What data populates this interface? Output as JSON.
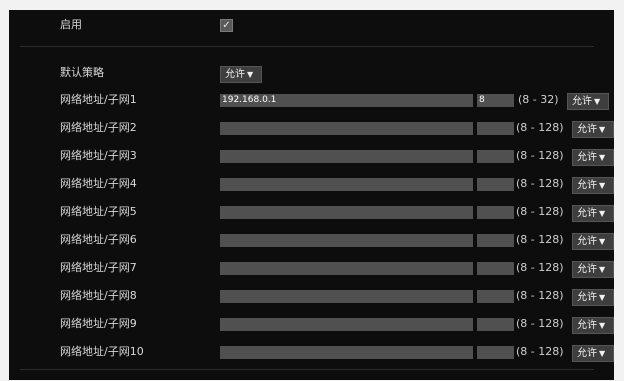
{
  "enable": {
    "label": "启用",
    "checked": true,
    "check_glyph": "✓"
  },
  "default_policy": {
    "label": "默认策略",
    "value": "允许",
    "arrow": "▼"
  },
  "rows": [
    {
      "label": "网络地址/子网1",
      "address": "192.168.0.1",
      "mask": "8",
      "range": "(8 - 32)",
      "policy": "允许",
      "arrow": "▼"
    },
    {
      "label": "网络地址/子网2",
      "address": "",
      "mask": "",
      "range": "(8 - 128)",
      "policy": "允许",
      "arrow": "▼"
    },
    {
      "label": "网络地址/子网3",
      "address": "",
      "mask": "",
      "range": "(8 - 128)",
      "policy": "允许",
      "arrow": "▼"
    },
    {
      "label": "网络地址/子网4",
      "address": "",
      "mask": "",
      "range": "(8 - 128)",
      "policy": "允许",
      "arrow": "▼"
    },
    {
      "label": "网络地址/子网5",
      "address": "",
      "mask": "",
      "range": "(8 - 128)",
      "policy": "允许",
      "arrow": "▼"
    },
    {
      "label": "网络地址/子网6",
      "address": "",
      "mask": "",
      "range": "(8 - 128)",
      "policy": "允许",
      "arrow": "▼"
    },
    {
      "label": "网络地址/子网7",
      "address": "",
      "mask": "",
      "range": "(8 - 128)",
      "policy": "允许",
      "arrow": "▼"
    },
    {
      "label": "网络地址/子网8",
      "address": "",
      "mask": "",
      "range": "(8 - 128)",
      "policy": "允许",
      "arrow": "▼"
    },
    {
      "label": "网络地址/子网9",
      "address": "",
      "mask": "",
      "range": "(8 - 128)",
      "policy": "允许",
      "arrow": "▼"
    },
    {
      "label": "网络地址/子网10",
      "address": "",
      "mask": "",
      "range": "(8 - 128)",
      "policy": "允许",
      "arrow": "▼"
    }
  ]
}
